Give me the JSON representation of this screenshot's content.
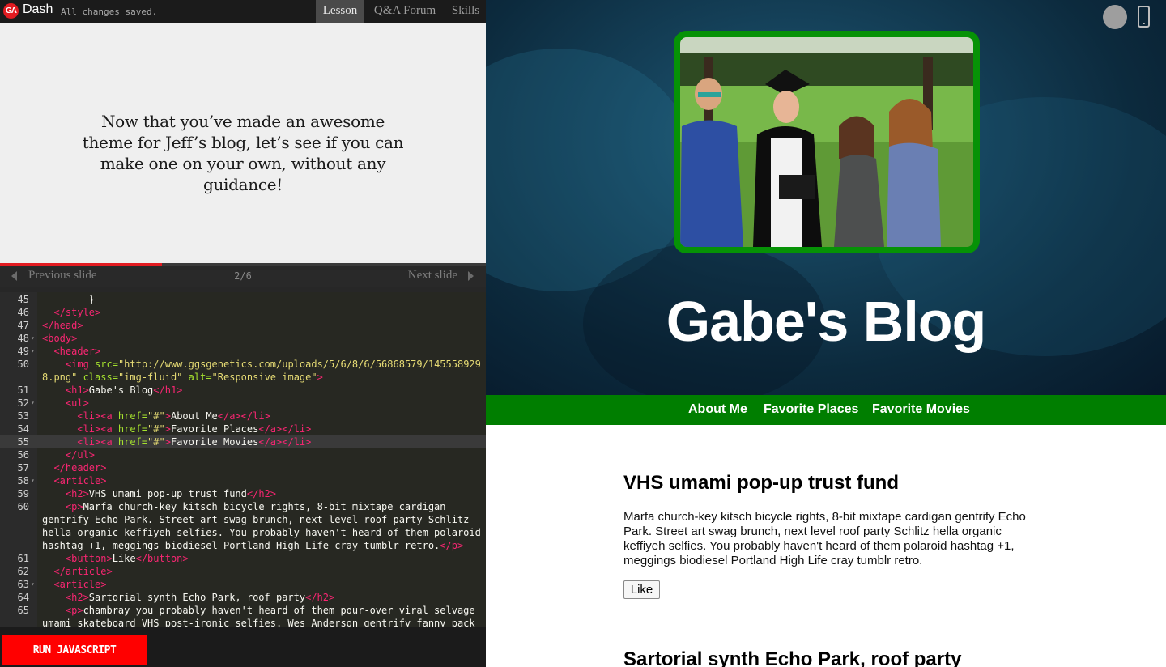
{
  "topbar": {
    "logo": "GA",
    "app_name": "Dash",
    "save_status": "All changes saved.",
    "tabs": [
      {
        "label": "Lesson",
        "active": true
      },
      {
        "label": "Q&A Forum",
        "active": false
      },
      {
        "label": "Skills",
        "active": false
      }
    ]
  },
  "lesson": {
    "text": "Now that you’ve made an awesome theme for Jeff’s blog, let’s see if you can make one on your own, without any guidance!",
    "progress": 0.333
  },
  "slide_nav": {
    "prev_label": "Previous slide",
    "next_label": "Next slide",
    "counter": "2/6"
  },
  "editor": {
    "lines": [
      {
        "n": "45",
        "fold": false,
        "tokens": [
          {
            "t": "        }",
            "c": "plain"
          }
        ]
      },
      {
        "n": "46",
        "fold": false,
        "tokens": [
          {
            "t": "  </style>",
            "c": "tag"
          }
        ]
      },
      {
        "n": "47",
        "fold": false,
        "tokens": [
          {
            "t": "</head>",
            "c": "tag"
          }
        ]
      },
      {
        "n": "48",
        "fold": true,
        "tokens": [
          {
            "t": "<body>",
            "c": "tag"
          }
        ]
      },
      {
        "n": "49",
        "fold": true,
        "tokens": [
          {
            "t": "  <header>",
            "c": "tag"
          }
        ]
      },
      {
        "n": "50",
        "fold": false,
        "tokens": [
          {
            "t": "    <img ",
            "c": "tag"
          },
          {
            "t": "src=",
            "c": "attr"
          },
          {
            "t": "\"http://www.ggsgenetics.com/uploads/5/6/8/6/56868579/145558929",
            "c": "str"
          }
        ]
      },
      {
        "n": "",
        "fold": false,
        "tokens": [
          {
            "t": "8.png\" ",
            "c": "str"
          },
          {
            "t": "class=",
            "c": "attr"
          },
          {
            "t": "\"img-fluid\" ",
            "c": "str"
          },
          {
            "t": "alt=",
            "c": "attr"
          },
          {
            "t": "\"Responsive image\"",
            "c": "str"
          },
          {
            "t": ">",
            "c": "tag"
          }
        ]
      },
      {
        "n": "51",
        "fold": false,
        "tokens": [
          {
            "t": "    <h1>",
            "c": "tag"
          },
          {
            "t": "Gabe's Blog",
            "c": "plain"
          },
          {
            "t": "</h1>",
            "c": "tag"
          }
        ]
      },
      {
        "n": "52",
        "fold": true,
        "tokens": [
          {
            "t": "    <ul>",
            "c": "tag"
          }
        ]
      },
      {
        "n": "53",
        "fold": false,
        "tokens": [
          {
            "t": "      <li><a ",
            "c": "tag"
          },
          {
            "t": "href=",
            "c": "attr"
          },
          {
            "t": "\"#\"",
            "c": "str"
          },
          {
            "t": ">",
            "c": "tag"
          },
          {
            "t": "About Me",
            "c": "plain"
          },
          {
            "t": "</a></li>",
            "c": "tag"
          }
        ]
      },
      {
        "n": "54",
        "fold": false,
        "tokens": [
          {
            "t": "      <li><a ",
            "c": "tag"
          },
          {
            "t": "href=",
            "c": "attr"
          },
          {
            "t": "\"#\"",
            "c": "str"
          },
          {
            "t": ">",
            "c": "tag"
          },
          {
            "t": "Favorite Places",
            "c": "plain"
          },
          {
            "t": "</a></li>",
            "c": "tag"
          }
        ]
      },
      {
        "n": "55",
        "fold": false,
        "active": true,
        "tokens": [
          {
            "t": "      <li><a ",
            "c": "tag"
          },
          {
            "t": "href=",
            "c": "attr"
          },
          {
            "t": "\"#\"",
            "c": "str"
          },
          {
            "t": ">",
            "c": "tag"
          },
          {
            "t": "Favorite Movies",
            "c": "plain"
          },
          {
            "t": "</a></li>",
            "c": "tag"
          }
        ]
      },
      {
        "n": "56",
        "fold": false,
        "tokens": [
          {
            "t": "    </ul>",
            "c": "tag"
          }
        ]
      },
      {
        "n": "57",
        "fold": false,
        "tokens": [
          {
            "t": "  </header>",
            "c": "tag"
          }
        ]
      },
      {
        "n": "58",
        "fold": true,
        "tokens": [
          {
            "t": "  <article>",
            "c": "tag"
          }
        ]
      },
      {
        "n": "59",
        "fold": false,
        "tokens": [
          {
            "t": "    <h2>",
            "c": "tag"
          },
          {
            "t": "VHS umami pop-up trust fund",
            "c": "plain"
          },
          {
            "t": "</h2>",
            "c": "tag"
          }
        ]
      },
      {
        "n": "60",
        "fold": false,
        "tokens": [
          {
            "t": "    <p>",
            "c": "tag"
          },
          {
            "t": "Marfa church-key kitsch bicycle rights, 8-bit mixtape cardigan",
            "c": "plain"
          }
        ]
      },
      {
        "n": "",
        "fold": false,
        "tokens": [
          {
            "t": "gentrify Echo Park. Street art swag brunch, next level roof party Schlitz",
            "c": "plain"
          }
        ]
      },
      {
        "n": "",
        "fold": false,
        "tokens": [
          {
            "t": "hella organic keffiyeh selfies. You probably haven't heard of them polaroid",
            "c": "plain"
          }
        ]
      },
      {
        "n": "",
        "fold": false,
        "tokens": [
          {
            "t": "hashtag +1, meggings biodiesel Portland High Life cray tumblr retro.",
            "c": "plain"
          },
          {
            "t": "</p>",
            "c": "tag"
          }
        ]
      },
      {
        "n": "61",
        "fold": false,
        "tokens": [
          {
            "t": "    <button>",
            "c": "tag"
          },
          {
            "t": "Like",
            "c": "plain"
          },
          {
            "t": "</button>",
            "c": "tag"
          }
        ]
      },
      {
        "n": "62",
        "fold": false,
        "tokens": [
          {
            "t": "  </article>",
            "c": "tag"
          }
        ]
      },
      {
        "n": "63",
        "fold": true,
        "tokens": [
          {
            "t": "  <article>",
            "c": "tag"
          }
        ]
      },
      {
        "n": "64",
        "fold": false,
        "tokens": [
          {
            "t": "    <h2>",
            "c": "tag"
          },
          {
            "t": "Sartorial synth Echo Park, roof party",
            "c": "plain"
          },
          {
            "t": "</h2>",
            "c": "tag"
          }
        ]
      },
      {
        "n": "65",
        "fold": false,
        "tokens": [
          {
            "t": "    <p>",
            "c": "tag"
          },
          {
            "t": "chambray you probably haven't heard of them pour-over viral selvage",
            "c": "plain"
          }
        ]
      },
      {
        "n": "",
        "fold": false,
        "tokens": [
          {
            "t": "umami skateboard VHS post-ironic selfies. Wes Anderson gentrify fanny pack",
            "c": "plain"
          }
        ]
      }
    ]
  },
  "run_button": {
    "label": "RUN JAVASCRIPT"
  },
  "preview": {
    "colors": {
      "nav": "#007e00",
      "frame": "#069206",
      "run": "#ff0000"
    },
    "blog_title": "Gabe's Blog",
    "nav_links": [
      "About Me",
      "Favorite Places",
      "Favorite Movies"
    ],
    "articles": [
      {
        "title": "VHS umami pop-up trust fund",
        "body": "Marfa church-key kitsch bicycle rights, 8-bit mixtape cardigan gentrify Echo Park. Street art swag brunch, next level roof party Schlitz hella organic keffiyeh selfies. You probably haven't heard of them polaroid hashtag +1, meggings biodiesel Portland High Life cray tumblr retro.",
        "button": "Like"
      },
      {
        "title": "Sartorial synth Echo Park, roof party"
      }
    ]
  }
}
